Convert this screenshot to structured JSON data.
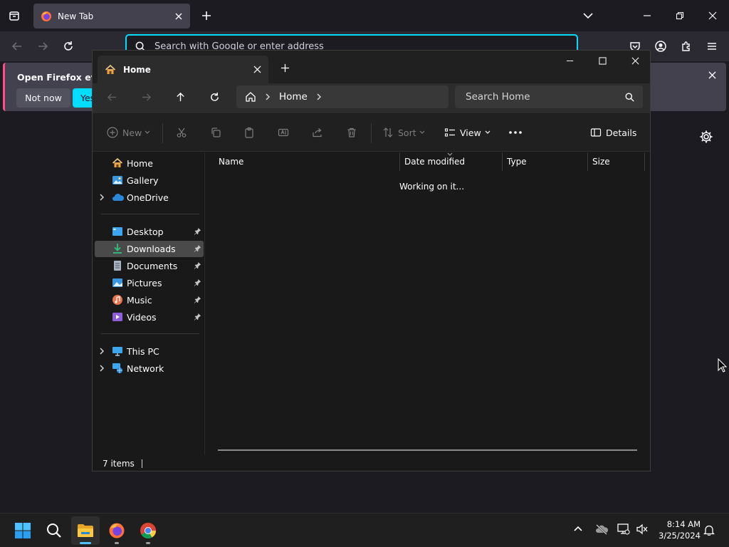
{
  "firefox": {
    "tab_title": "New Tab",
    "url_placeholder": "Search with Google or enter address",
    "notification": {
      "message": "Open Firefox every",
      "not_now_label": "Not now",
      "yes_label": "Yes"
    },
    "accent": "#00ddff"
  },
  "explorer": {
    "tab_title": "Home",
    "breadcrumb_label": "Home",
    "search_placeholder": "Search Home",
    "commands": {
      "new_label": "New",
      "sort_label": "Sort",
      "view_label": "View",
      "details_label": "Details"
    },
    "nav": {
      "home": "Home",
      "gallery": "Gallery",
      "onedrive": "OneDrive",
      "desktop": "Desktop",
      "downloads": "Downloads",
      "documents": "Documents",
      "pictures": "Pictures",
      "music": "Music",
      "videos": "Videos",
      "this_pc": "This PC",
      "network": "Network"
    },
    "columns": {
      "name": "Name",
      "date_modified": "Date modified",
      "type": "Type",
      "size": "Size"
    },
    "loading_text": "Working on it...",
    "status_text": "7 items"
  },
  "taskbar": {
    "time": "8:14 AM",
    "date": "3/25/2024"
  }
}
